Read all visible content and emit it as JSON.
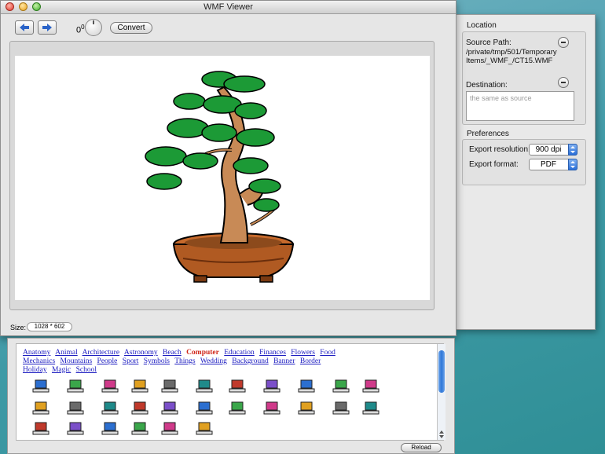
{
  "window": {
    "title": "WMF Viewer"
  },
  "toolbar": {
    "back_icon": "left-arrow-icon",
    "forward_icon": "right-arrow-icon",
    "rotation_value": "0",
    "rotation_unit": "0",
    "convert_label": "Convert"
  },
  "status": {
    "size_label": "Size:",
    "size_value": "1028 * 602"
  },
  "drawer": {
    "location": {
      "title": "Location",
      "source_label": "Source Path:",
      "source_value": "/private/tmp/501/TemporaryItems/_WMF_/CT15.WMF",
      "destination_label": "Destination:",
      "destination_placeholder": "the same as source"
    },
    "preferences": {
      "title": "Preferences",
      "resolution_label": "Export resolution:",
      "resolution_value": "900 dpi",
      "format_label": "Export format:",
      "format_value": "PDF"
    }
  },
  "browser": {
    "categories": [
      "Anatomy",
      "Animal",
      "Architecture",
      "Astronomy",
      "Beach",
      "Computer",
      "Education",
      "Finances",
      "Flowers",
      "Food",
      "Mechanics",
      "Mountains",
      "People",
      "Sport",
      "Symbols",
      "Things",
      "Wedding",
      "Background",
      "Banner",
      "Border",
      "Holiday",
      "Magic",
      "School"
    ],
    "active_category": "Computer",
    "reload_label": "Reload"
  },
  "colors": {
    "link": "#1a1ac0",
    "active_link": "#d0261a",
    "accent": "#2e76d8",
    "desktop": "#3f9aa6"
  }
}
